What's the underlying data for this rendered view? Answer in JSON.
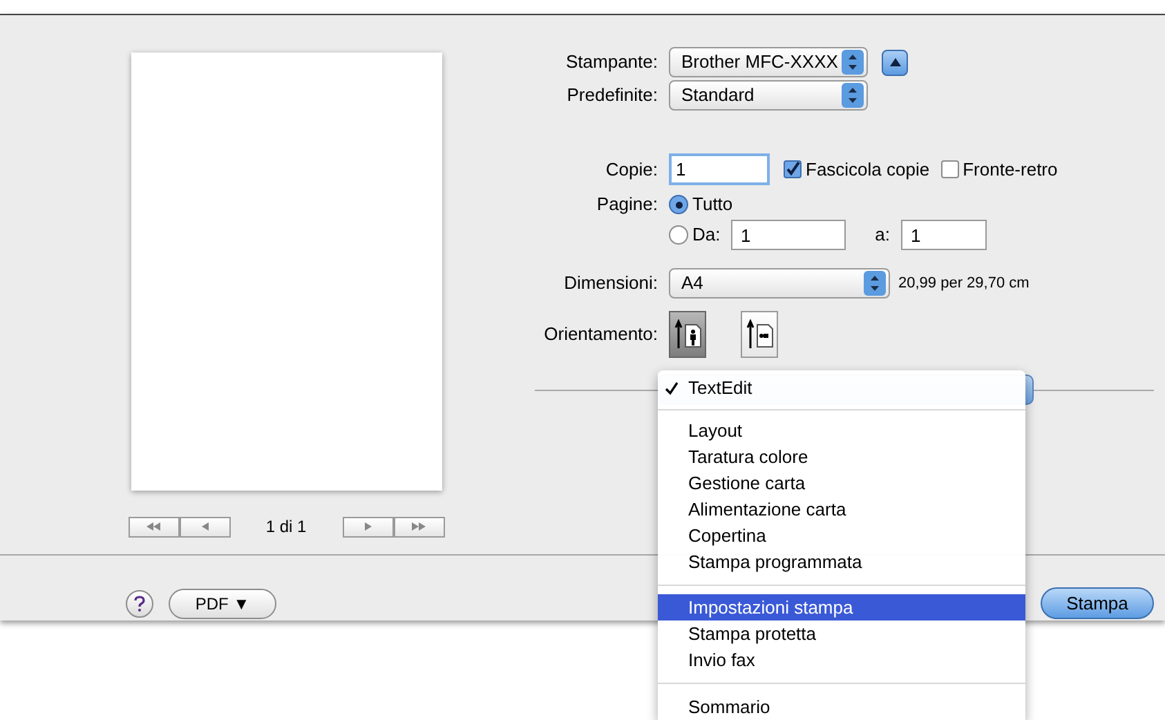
{
  "printer": {
    "label": "Stampante:",
    "value": "Brother MFC-XXXX"
  },
  "presets": {
    "label": "Predefinite:",
    "value": "Standard"
  },
  "copies": {
    "label": "Copie:",
    "value": "1"
  },
  "collate": {
    "label": "Fascicola copie",
    "checked": true
  },
  "duplex": {
    "label": "Fronte-retro",
    "checked": false
  },
  "pages": {
    "label": "Pagine:",
    "options": [
      {
        "label": "Tutto",
        "selected": true
      },
      {
        "label": "Da:",
        "selected": false
      }
    ],
    "from": "1",
    "to_label": "a:",
    "to": "1"
  },
  "paper_size": {
    "label": "Dimensioni:",
    "value": "A4",
    "dimensions": "20,99 per 29,70 cm"
  },
  "orientation": {
    "label": "Orientamento:",
    "options": [
      {
        "kind": "portrait",
        "selected": true
      },
      {
        "kind": "landscape",
        "selected": false
      }
    ]
  },
  "preview": {
    "page_counter": "1 di 1"
  },
  "pdf_button": "PDF ▼",
  "print_button": "Stampa",
  "menu": [
    {
      "kind": "item",
      "label": "TextEdit",
      "checked": true,
      "selected": false
    },
    {
      "kind": "separator"
    },
    {
      "kind": "item",
      "label": "Layout",
      "checked": false,
      "selected": false
    },
    {
      "kind": "item",
      "label": "Taratura colore",
      "checked": false,
      "selected": false
    },
    {
      "kind": "item",
      "label": "Gestione carta",
      "checked": false,
      "selected": false
    },
    {
      "kind": "item",
      "label": "Alimentazione carta",
      "checked": false,
      "selected": false
    },
    {
      "kind": "item",
      "label": "Copertina",
      "checked": false,
      "selected": false
    },
    {
      "kind": "item",
      "label": "Stampa programmata",
      "checked": false,
      "selected": false
    },
    {
      "kind": "separator"
    },
    {
      "kind": "item",
      "label": "Impostazioni stampa",
      "checked": false,
      "selected": true
    },
    {
      "kind": "item",
      "label": "Stampa protetta",
      "checked": false,
      "selected": false
    },
    {
      "kind": "item",
      "label": "Invio fax",
      "checked": false,
      "selected": false
    },
    {
      "kind": "separator"
    },
    {
      "kind": "item",
      "label": "Sommario",
      "checked": false,
      "selected": false
    }
  ]
}
